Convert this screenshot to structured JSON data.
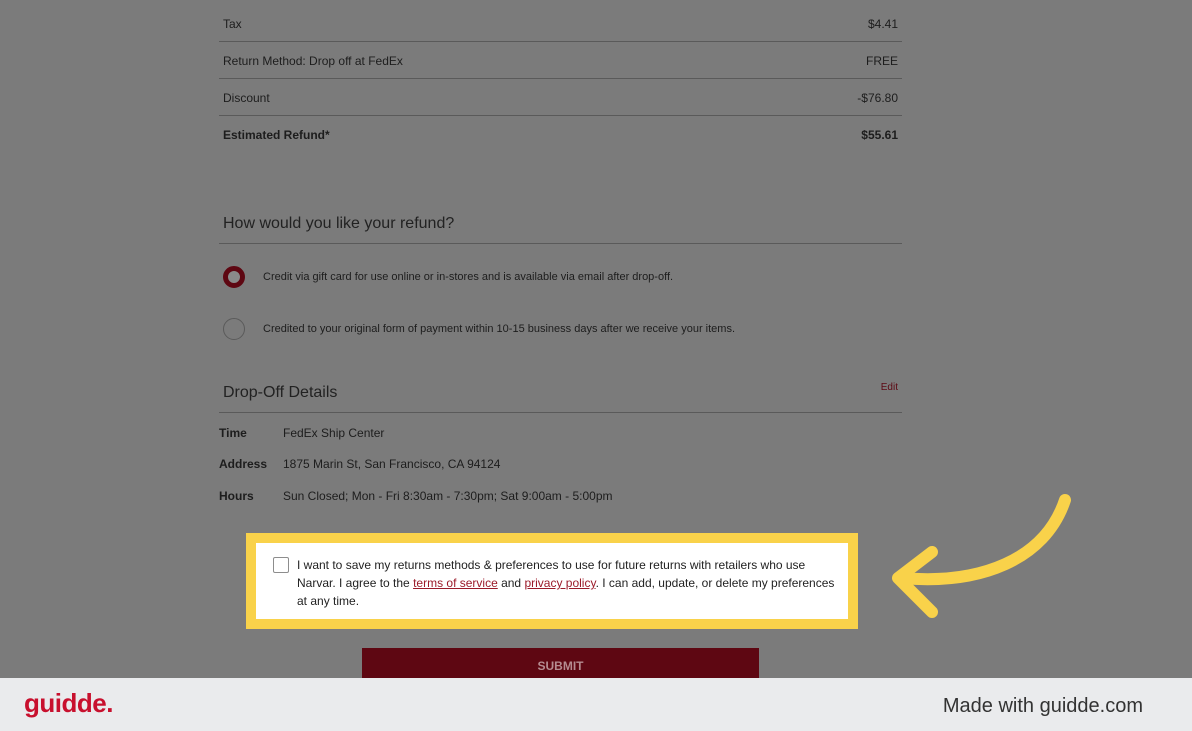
{
  "summary": {
    "rows": [
      {
        "label": "Tax",
        "value": "$4.41"
      },
      {
        "label": "Return Method: Drop off at FedEx",
        "value": "FREE"
      },
      {
        "label": "Discount",
        "value": "-$76.80"
      },
      {
        "label": "Estimated Refund*",
        "value": "$55.61"
      }
    ]
  },
  "refund": {
    "title": "How would you like your refund?",
    "options": [
      {
        "label": "Credit via gift card for use online or in-stores and is available via email after drop-off.",
        "selected": true
      },
      {
        "label": "Credited to your original form of payment within 10-15 business days after we receive your items.",
        "selected": false
      }
    ]
  },
  "dropoff": {
    "title": "Drop-Off Details",
    "edit_label": "Edit",
    "details": [
      {
        "label": "Time",
        "value": "FedEx Ship Center"
      },
      {
        "label": "Address",
        "value": "1875 Marin St, San Francisco, CA 94124"
      },
      {
        "label": "Hours",
        "value": "Sun Closed; Mon - Fri 8:30am - 7:30pm; Sat 9:00am - 5:00pm"
      }
    ]
  },
  "consent": {
    "text_before": "I want to save my returns methods & preferences to use for future returns with retailers who use Narvar. I agree to the ",
    "terms_label": "terms of service",
    "text_middle": " and ",
    "privacy_label": "privacy policy",
    "text_after": ". I can add, update, or delete my preferences at any time.",
    "checked": false
  },
  "submit_label": "SUBMIT",
  "colors": {
    "highlight": "#f9d24a",
    "brand": "#5e0712",
    "logo": "#c8102e"
  },
  "footer": {
    "logo": "guidde.",
    "made_with": "Made with guidde.com"
  }
}
